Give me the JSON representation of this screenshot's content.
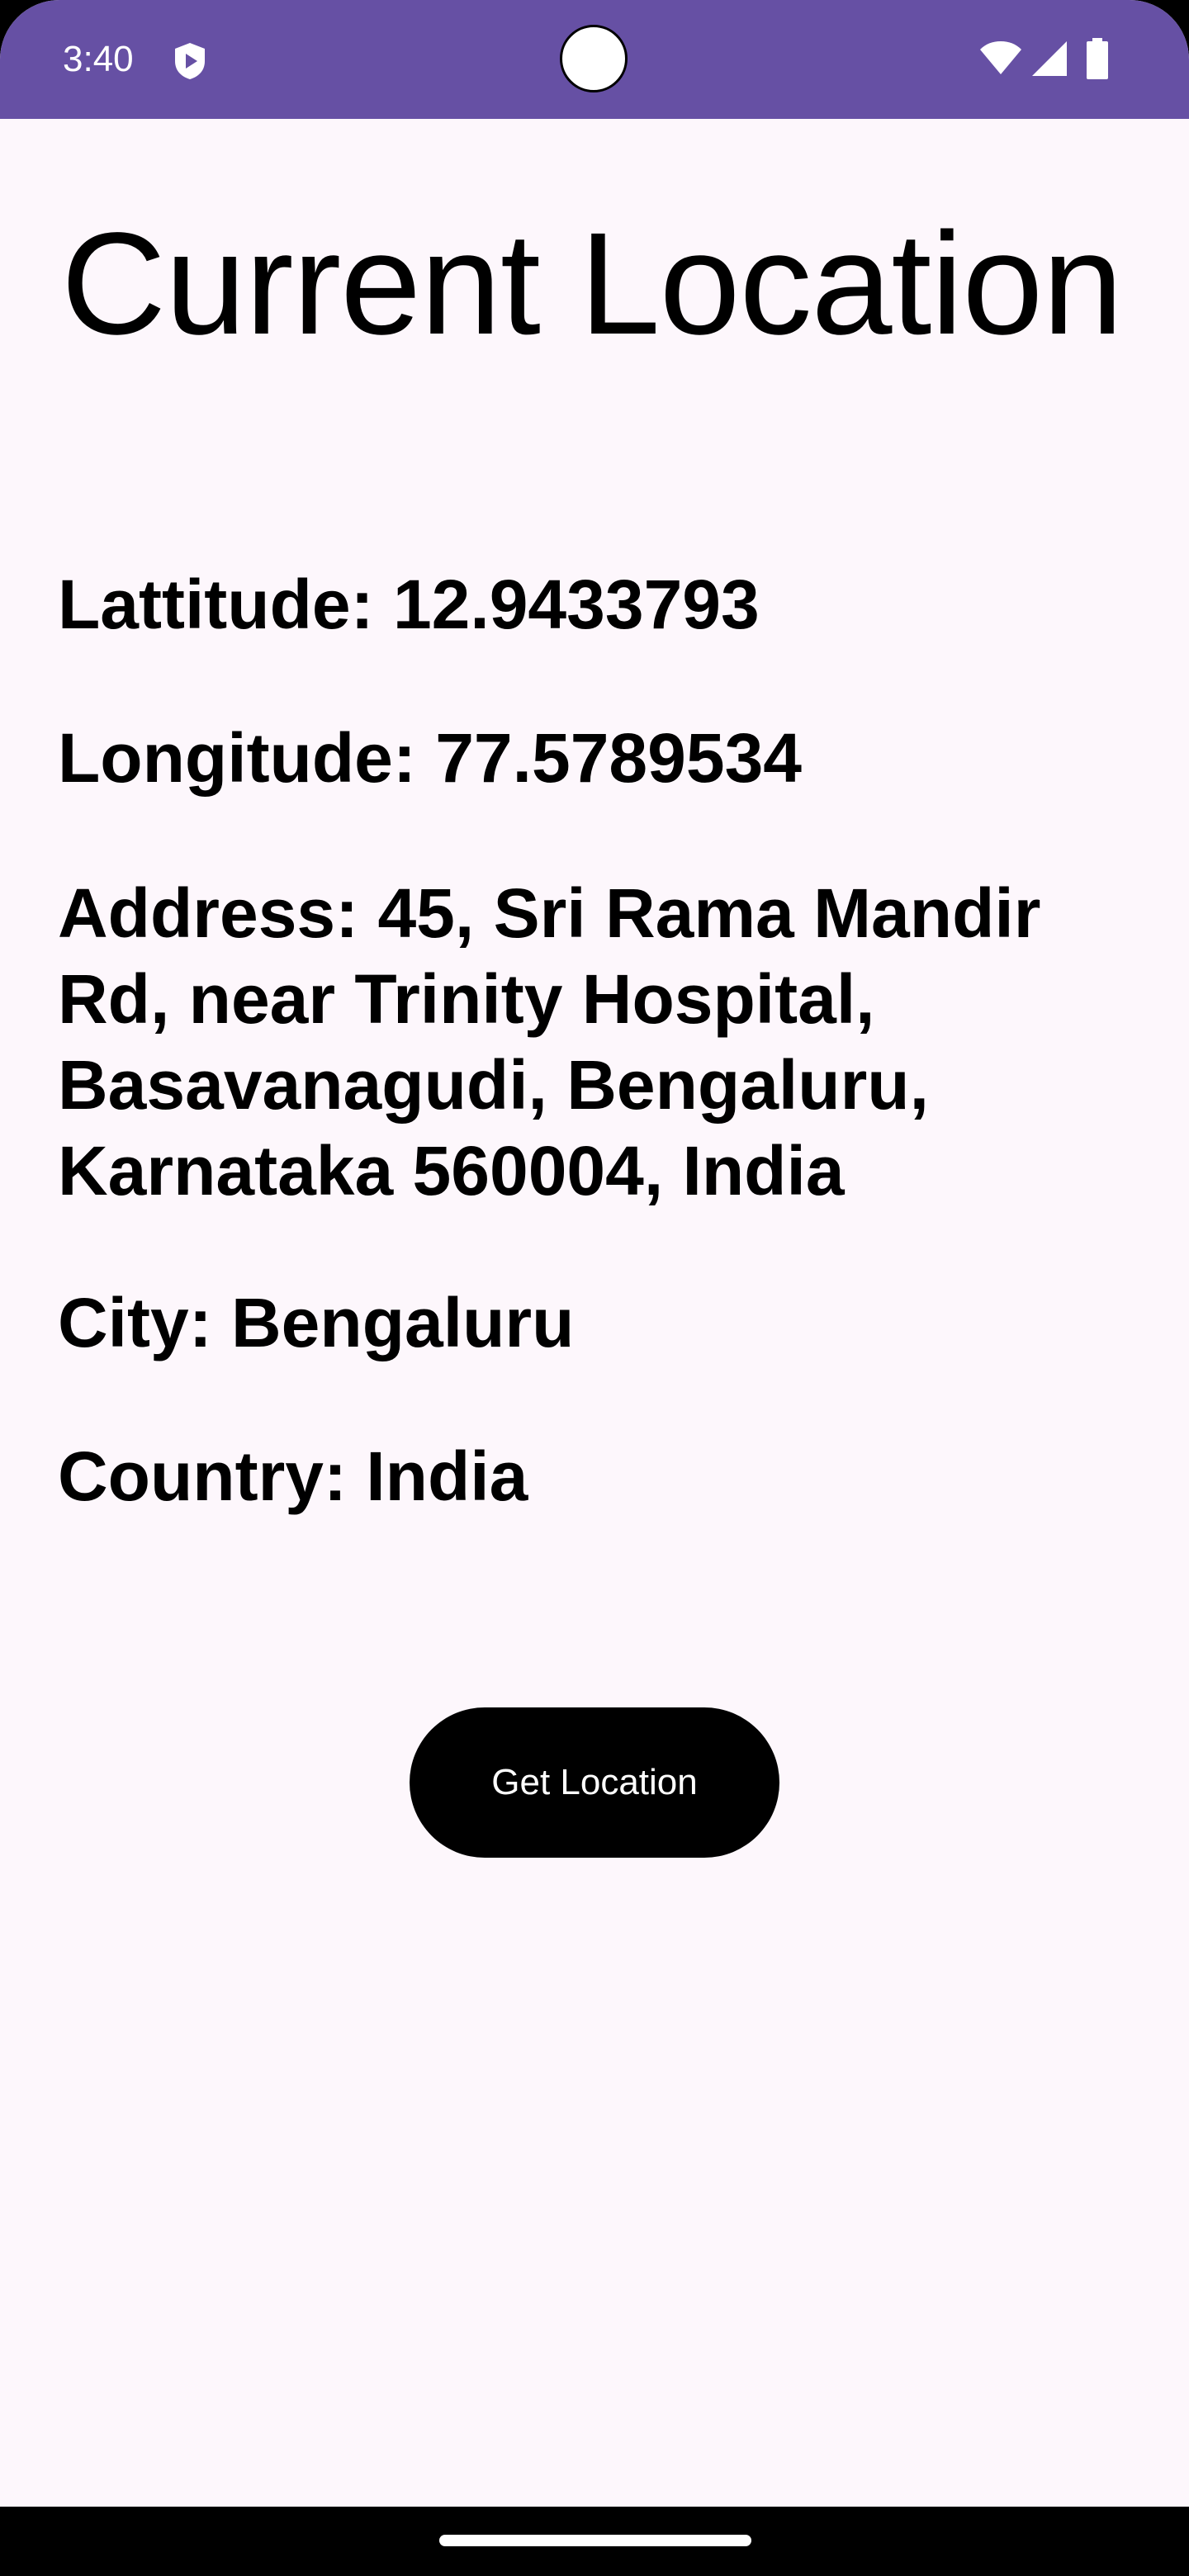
{
  "status_bar": {
    "time": "3:40",
    "icons": [
      "shield-play-icon",
      "wifi-icon",
      "cell-signal-icon",
      "battery-icon"
    ]
  },
  "page": {
    "title": "Current Location"
  },
  "location": {
    "latitude_label": "Lattitude:",
    "latitude_value": "12.9433793",
    "longitude_label": "Longitude:",
    "longitude_value": "77.5789534",
    "address_label": "Address:",
    "address_value": "45, Sri Rama Mandir Rd, near Trinity Hospital, Basavanagudi, Bengaluru, Karnataka 560004, India",
    "city_label": "City:",
    "city_value": "Bengaluru",
    "country_label": "Country:",
    "country_value": "India"
  },
  "actions": {
    "get_location_label": "Get Location"
  },
  "colors": {
    "status_bar": "#6650a4",
    "background": "#fdf7fc",
    "button": "#000000",
    "text": "#000000"
  }
}
